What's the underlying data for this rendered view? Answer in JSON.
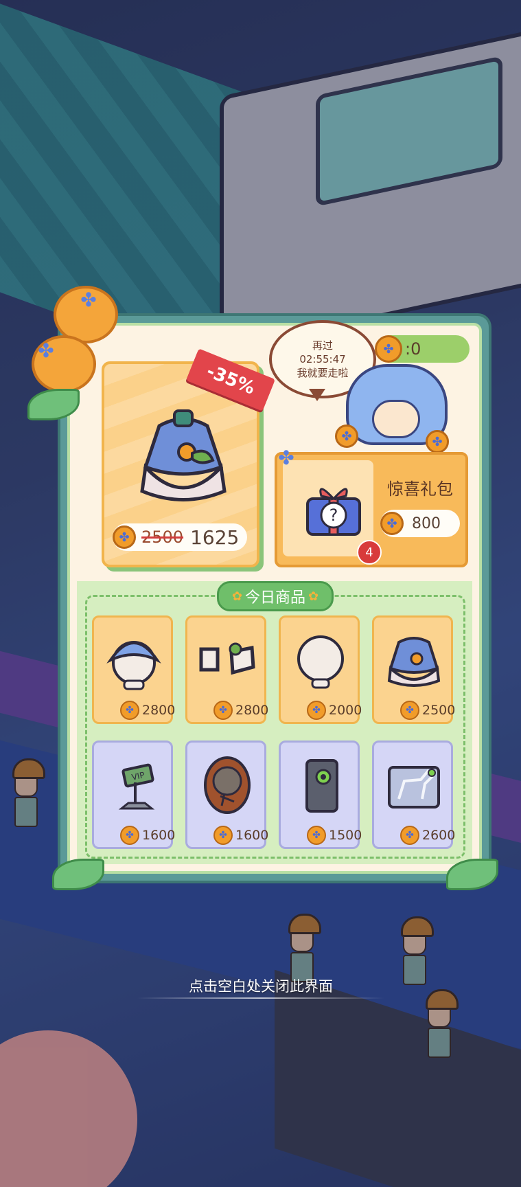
{
  "timer": {
    "line1": "再过",
    "time": "02:55:47",
    "line3": "我就要走啦"
  },
  "currency": {
    "count": ":0",
    "icon": "blue-flower-coin-icon"
  },
  "featured": {
    "discount": "-35%",
    "old_price": "2500",
    "new_price": "1625",
    "icon": "hood-outfit-icon"
  },
  "surprise_pack": {
    "title": "惊喜礼包",
    "price": "800",
    "badge": "4",
    "icon": "mystery-gift-icon"
  },
  "section": {
    "title": "今日商品"
  },
  "items": [
    {
      "price": "2800",
      "icon": "blue-hood-icon",
      "theme": "warm"
    },
    {
      "price": "2800",
      "icon": "shoes-icon",
      "theme": "warm"
    },
    {
      "price": "2000",
      "icon": "bald-head-icon",
      "theme": "warm"
    },
    {
      "price": "2500",
      "icon": "cloak-outfit-icon",
      "theme": "warm"
    },
    {
      "price": "1600",
      "icon": "vip-sign-icon",
      "theme": "cool"
    },
    {
      "price": "1600",
      "icon": "fossil-plaque-icon",
      "theme": "cool"
    },
    {
      "price": "1500",
      "icon": "gadget-card-icon",
      "theme": "cool"
    },
    {
      "price": "2600",
      "icon": "dinosaur-display-case-icon",
      "theme": "cool"
    }
  ],
  "vip_sign_text": "VIP",
  "close_hint": "点击空白处关闭此界面",
  "colors": {
    "panel_border": "#5b9a98",
    "accent_orange": "#f19c2a",
    "discount_red": "#e2454b",
    "section_green": "#6fbf6a"
  }
}
